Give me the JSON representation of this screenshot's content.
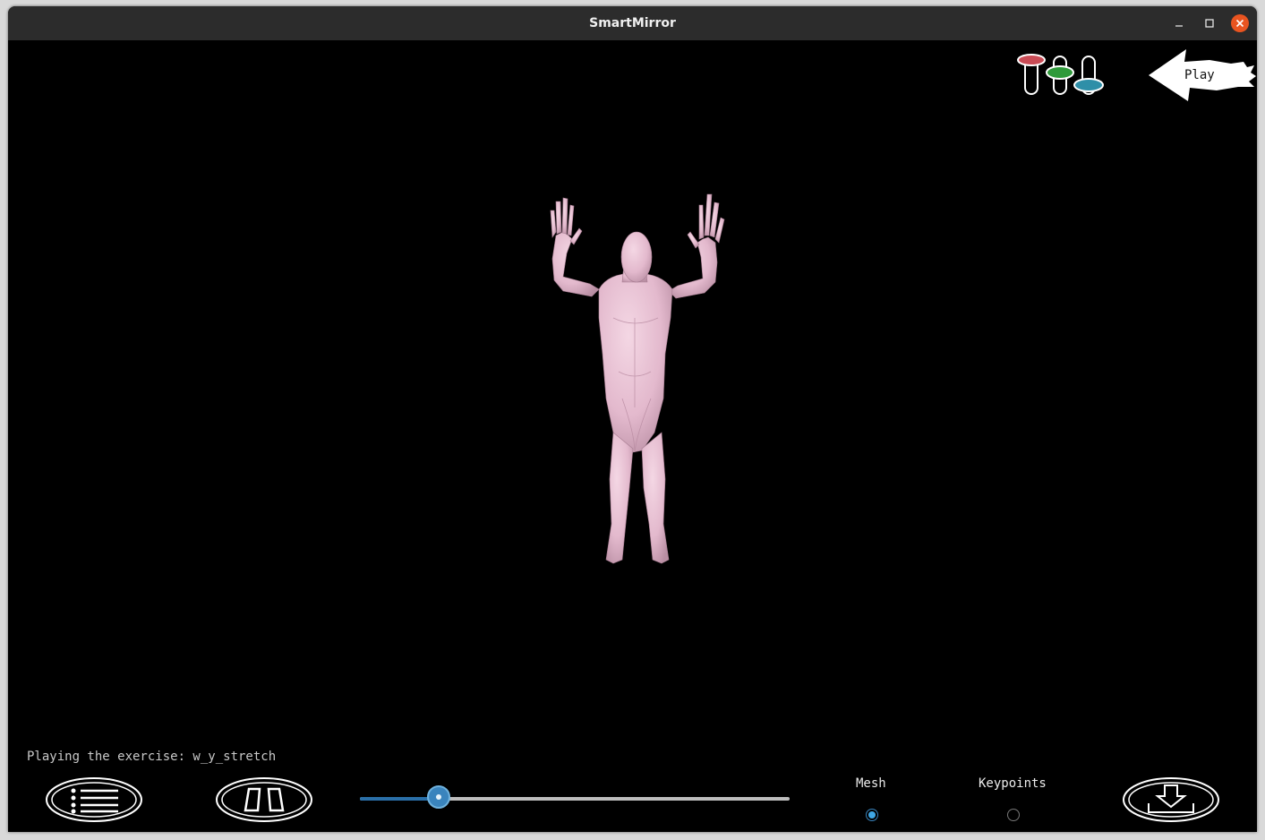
{
  "window": {
    "title": "SmartMirror",
    "minimize_icon": "minimize-icon",
    "maximize_icon": "maximize-icon",
    "close_icon": "close-icon",
    "close_color": "#e95420"
  },
  "toolbar": {
    "settings_icon": "sliders-icon",
    "play_label": "Play",
    "play_icon": "arrow-left-icon"
  },
  "viewport": {
    "figure": "3d-human-mesh",
    "mesh_color": "#e8c0d4"
  },
  "status": {
    "text": "Playing the exercise: w_y_stretch"
  },
  "controls": {
    "list_button_icon": "list-icon",
    "compare_button_icon": "mirror-pads-icon",
    "download_button_icon": "download-icon",
    "progress_fraction": 0.18,
    "accent_color": "#3a84bd"
  },
  "view_mode": {
    "options": [
      {
        "label": "Mesh",
        "checked": true
      },
      {
        "label": "Keypoints",
        "checked": false
      }
    ]
  }
}
